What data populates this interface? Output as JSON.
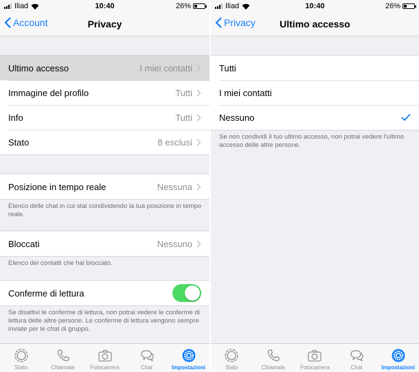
{
  "left": {
    "status": {
      "carrier": "Iliad",
      "time": "10:40",
      "battery": "26%",
      "battery_level": 0.26
    },
    "nav": {
      "back_label": "Account",
      "title": "Privacy"
    },
    "rows": [
      {
        "label": "Ultimo accesso",
        "value": "I miei contatti"
      },
      {
        "label": "Immagine del profilo",
        "value": "Tutti"
      },
      {
        "label": "Info",
        "value": "Tutti"
      },
      {
        "label": "Stato",
        "value": "8 esclusi"
      }
    ],
    "location": {
      "label": "Posizione in tempo reale",
      "value": "Nessuna",
      "footer": "Elenco delle chat in cui stai condividendo la tua posizione in tempo reale."
    },
    "blocked": {
      "label": "Bloccati",
      "value": "Nessuno",
      "footer": "Elenco dei contatti che hai bloccato."
    },
    "read_receipts": {
      "label": "Conferme di lettura",
      "enabled": true,
      "footer": "Se disattivi le conferme di lettura, non potrai vedere le conferme di lettura delle altre persone. Le conferme di lettura vengono sempre inviate per le chat di gruppo."
    }
  },
  "right": {
    "status": {
      "carrier": "Iliad",
      "time": "10:40",
      "battery": "26%",
      "battery_level": 0.26
    },
    "nav": {
      "back_label": "Privacy",
      "title": "Ultimo accesso"
    },
    "options": [
      {
        "label": "Tutti",
        "selected": false
      },
      {
        "label": "I miei contatti",
        "selected": false
      },
      {
        "label": "Nessuno",
        "selected": true
      }
    ],
    "footer": "Se non condividi il tuo ultimo accesso, non potrai vedere l'ultimo accesso delle altre persone."
  },
  "tabs": [
    {
      "label": "Stato",
      "icon": "status-icon",
      "active": false
    },
    {
      "label": "Chiamate",
      "icon": "phone-icon",
      "active": false
    },
    {
      "label": "Fotocamera",
      "icon": "camera-icon",
      "active": false
    },
    {
      "label": "Chat",
      "icon": "chat-bubbles-icon",
      "active": false
    },
    {
      "label": "Impostazioni",
      "icon": "gear-icon",
      "active": true
    }
  ],
  "colors": {
    "accent": "#147efb",
    "toggle_on": "#4cd964",
    "background": "#efeff4"
  }
}
